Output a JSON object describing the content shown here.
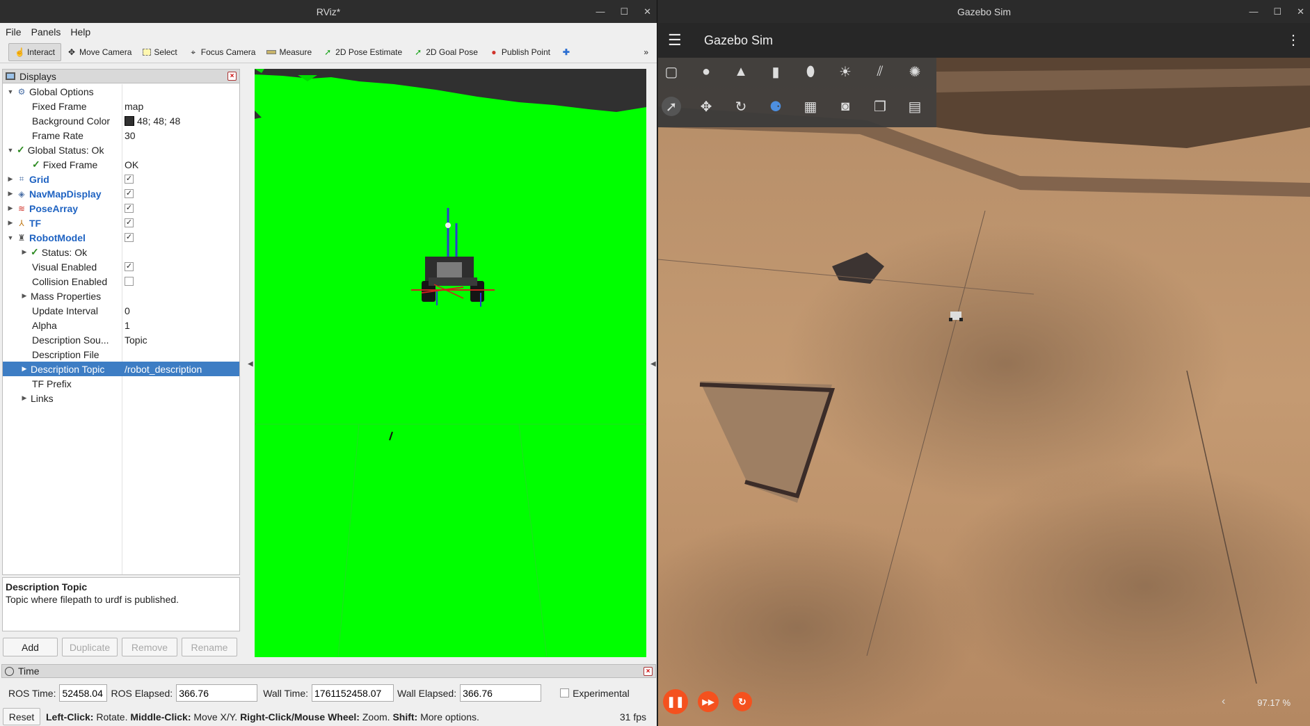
{
  "rviz": {
    "title": "RViz*",
    "window_controls": {
      "minimize": "—",
      "maximize": "☐",
      "close": "✕"
    },
    "menu": [
      "File",
      "Panels",
      "Help"
    ],
    "toolbar": [
      {
        "label": "Interact",
        "icon": "pointer-icon"
      },
      {
        "label": "Move Camera",
        "icon": "move-camera-icon"
      },
      {
        "label": "Select",
        "icon": "select-icon"
      },
      {
        "label": "Focus Camera",
        "icon": "focus-camera-icon"
      },
      {
        "label": "Measure",
        "icon": "ruler-icon"
      },
      {
        "label": "2D Pose Estimate",
        "icon": "green-arrow-icon"
      },
      {
        "label": "2D Goal Pose",
        "icon": "green-arrow-icon"
      },
      {
        "label": "Publish Point",
        "icon": "map-pin-icon"
      }
    ],
    "displays_panel": {
      "title": "Displays",
      "rows": [
        {
          "label": "Global Options",
          "value": ""
        },
        {
          "label": "Fixed Frame",
          "value": "map"
        },
        {
          "label": "Background Color",
          "value": "48; 48; 48"
        },
        {
          "label": "Frame Rate",
          "value": "30"
        },
        {
          "label": "Global Status: Ok",
          "value": ""
        },
        {
          "label": "Fixed Frame",
          "value": "OK"
        },
        {
          "label": "Grid",
          "value": ""
        },
        {
          "label": "NavMapDisplay",
          "value": ""
        },
        {
          "label": "PoseArray",
          "value": ""
        },
        {
          "label": "TF",
          "value": ""
        },
        {
          "label": "RobotModel",
          "value": ""
        },
        {
          "label": "Status: Ok",
          "value": ""
        },
        {
          "label": "Visual Enabled",
          "value": ""
        },
        {
          "label": "Collision Enabled",
          "value": ""
        },
        {
          "label": "Mass Properties",
          "value": ""
        },
        {
          "label": "Update Interval",
          "value": "0"
        },
        {
          "label": "Alpha",
          "value": "1"
        },
        {
          "label": "Description Sou...",
          "value": "Topic"
        },
        {
          "label": "Description File",
          "value": ""
        },
        {
          "label": "Description Topic",
          "value": "/robot_description"
        },
        {
          "label": "TF Prefix",
          "value": ""
        },
        {
          "label": "Links",
          "value": ""
        }
      ]
    },
    "description_box": {
      "title": "Description Topic",
      "text": "Topic where filepath to urdf is published."
    },
    "buttons": {
      "add": "Add",
      "duplicate": "Duplicate",
      "remove": "Remove",
      "rename": "Rename"
    },
    "time_panel": {
      "title": "Time",
      "ros_time_label": "ROS Time:",
      "ros_time": "52458.04",
      "ros_elapsed_label": "ROS Elapsed:",
      "ros_elapsed": "366.76",
      "wall_time_label": "Wall Time:",
      "wall_time": "1761152458.07",
      "wall_elapsed_label": "Wall Elapsed:",
      "wall_elapsed": "366.76",
      "experimental": "Experimental"
    },
    "status": {
      "reset": "Reset",
      "k1": "Left-Click:",
      "v1": "Rotate.",
      "k2": "Middle-Click:",
      "v2": "Move X/Y.",
      "k3": "Right-Click/Mouse Wheel:",
      "v3": "Zoom.",
      "k4": "Shift:",
      "v4": "More options.",
      "fps": "31 fps"
    },
    "colors": {
      "viewport_green": "#00ff00",
      "selection": "#3d7dc4"
    }
  },
  "gazebo": {
    "title": "Gazebo Sim",
    "app_name": "Gazebo Sim",
    "window_controls": {
      "minimize": "—",
      "maximize": "☐",
      "close": "✕"
    },
    "rtf": "97.17 %",
    "collapse": "‹",
    "colors": {
      "accent": "#f4511e"
    }
  }
}
